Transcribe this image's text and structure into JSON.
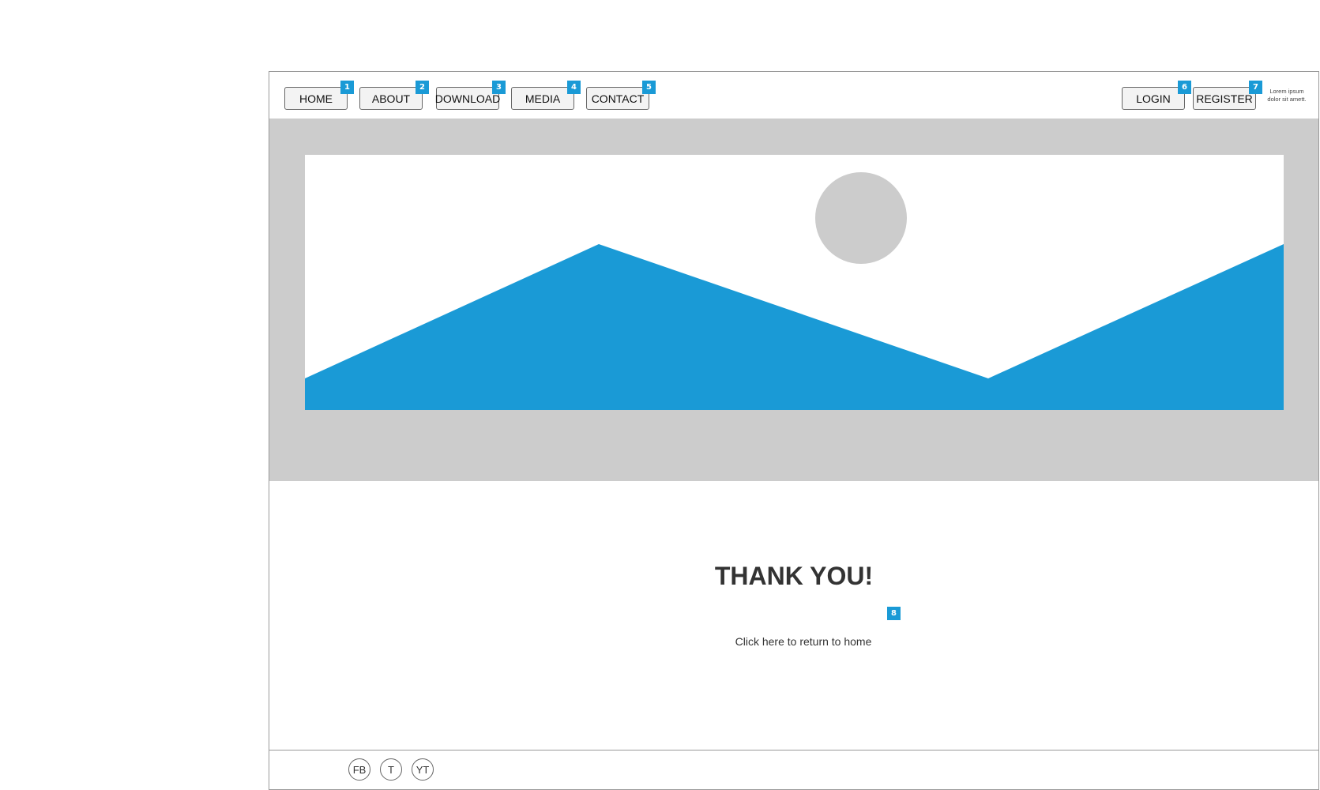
{
  "nav": {
    "left_items": [
      {
        "label": "HOME",
        "badge": "1"
      },
      {
        "label": "ABOUT",
        "badge": "2"
      },
      {
        "label": "DOWNLOAD",
        "badge": "3"
      },
      {
        "label": "MEDIA",
        "badge": "4"
      },
      {
        "label": "CONTACT",
        "badge": "5"
      }
    ],
    "right_items": [
      {
        "label": "LOGIN",
        "badge": "6"
      },
      {
        "label": "REGISTER",
        "badge": "7"
      }
    ],
    "note_line1": "Lorem ipsum",
    "note_line2": "dolor sit amett."
  },
  "hero": {
    "image_icon": "image-placeholder-icon",
    "background_color": "#cccccc",
    "mountain_color": "#1a9ad6",
    "sun_color": "#cccccc"
  },
  "content": {
    "title": "THANK YOU!",
    "return_link": "Click here to return to home",
    "return_badge": "8"
  },
  "footer": {
    "social": [
      "FB",
      "T",
      "YT"
    ]
  },
  "colors": {
    "badge": "#1a9ad6"
  }
}
